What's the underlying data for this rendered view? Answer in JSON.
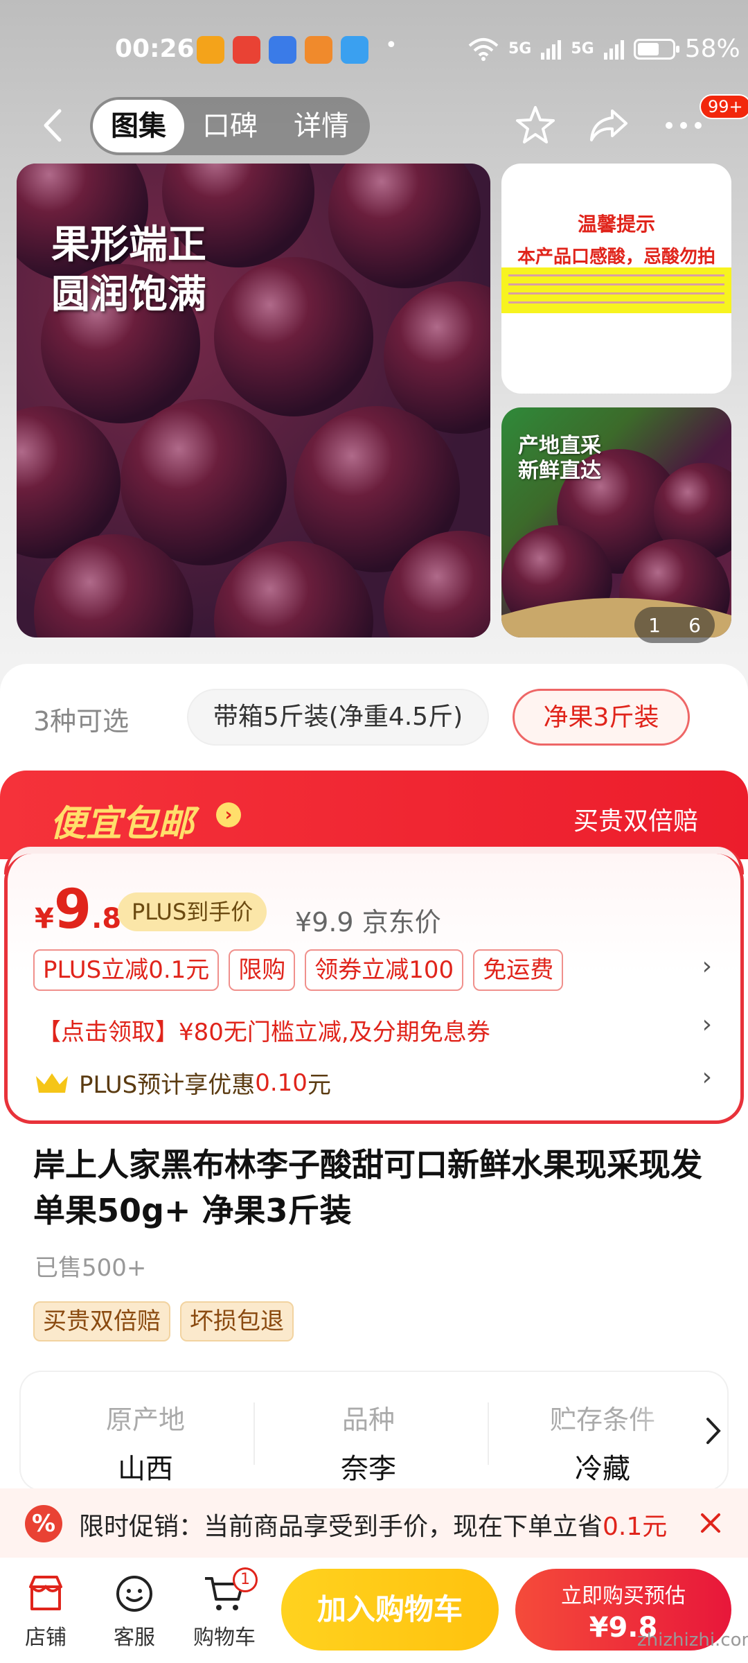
{
  "status_bar": {
    "time": "00:26",
    "dot": "•",
    "network1": "5G",
    "network2": "5G",
    "battery": "58%",
    "app_icon_colors": [
      "#f4a31a",
      "#e94234",
      "#3a7be8",
      "#f08a2c",
      "#3aa0f0"
    ]
  },
  "nav": {
    "tabs": [
      {
        "label": "图集",
        "active": true
      },
      {
        "label": "口碑",
        "active": false
      },
      {
        "label": "详情",
        "active": false
      }
    ],
    "more_badge": "99+"
  },
  "gallery": {
    "main_caption_line1": "果形端正",
    "main_caption_line2": "圆润饱满",
    "tip_title": "温馨提示",
    "tip_subtitle": "本产品口感酸，忌酸勿拍",
    "side_caption_line1": "产地直采",
    "side_caption_line2": "新鲜直达",
    "pager_current": "1",
    "pager_total": "6"
  },
  "specs": {
    "count_label": "3种可选",
    "options": [
      {
        "label": "带箱5斤装(净重4.5斤)",
        "selected": false
      },
      {
        "label": "净果3斤装",
        "selected": true
      }
    ]
  },
  "promo": {
    "title": "便宜包邮",
    "right_label": "买贵双倍赔",
    "price_yen": "¥",
    "price_int": "9",
    "price_dec": ".8",
    "plus_price_tag": "PLUS到手价",
    "jd_price_value": "¥9.9",
    "jd_price_label": "京东价",
    "tags": [
      "PLUS立减0.1元",
      "限购",
      "领券立减100",
      "免运费"
    ],
    "coupon_line": "【点击领取】¥80无门槛立减,及分期免息券",
    "plus_prefix": "PLUS预计享优惠",
    "plus_amount": "0.10",
    "plus_unit": "元"
  },
  "product": {
    "title": "岸上人家黑布林李子酸甜可口新鲜水果现采现发单果50g+ 净果3斤装",
    "sold": "已售500+",
    "service_tags": [
      "买贵双倍赔",
      "坏损包退"
    ]
  },
  "attributes": [
    {
      "key": "原产地",
      "value": "山西"
    },
    {
      "key": "品种",
      "value": "奈李"
    },
    {
      "key": "贮存条件",
      "value": "冷藏"
    }
  ],
  "toast": {
    "icon": "%",
    "text_prefix": "限时促销：当前商品享受到手价，现在下单立省",
    "amount": "0.1元"
  },
  "bottom_bar": {
    "shop": "店铺",
    "service": "客服",
    "cart": "购物车",
    "cart_badge": "1",
    "add_to_cart": "加入购物车",
    "buy_line1": "立即购买预估",
    "buy_line2": "¥9.8"
  },
  "watermark": "zhizhizhi.com"
}
